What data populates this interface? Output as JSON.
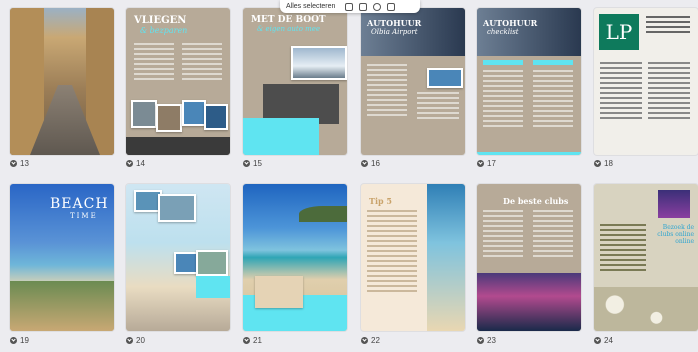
{
  "toolbar": {
    "select_all_label": "Alles selecteren"
  },
  "pages": [
    {
      "number": "13"
    },
    {
      "number": "14",
      "title": "VLIEGEN",
      "subtitle": "& bezparen"
    },
    {
      "number": "15",
      "title": "MET DE BOOT",
      "subtitle": "& eigen auto mee"
    },
    {
      "number": "16",
      "title": "AUTOHUUR",
      "subtitle": "Olbia Airport"
    },
    {
      "number": "17",
      "title": "AUTOHUUR",
      "subtitle": "checklist"
    },
    {
      "number": "18",
      "logo": "LP"
    },
    {
      "number": "19",
      "title": "BEACH",
      "subtitle": "TIME"
    },
    {
      "number": "20"
    },
    {
      "number": "21"
    },
    {
      "number": "22",
      "title": "Tip 5"
    },
    {
      "number": "23",
      "title": "De beste clubs"
    },
    {
      "number": "24",
      "subtitle": "Bezoek de clubs online online"
    }
  ],
  "colors": {
    "accent_cyan": "#5fe4f1",
    "beige": "#b7aa98",
    "background": "#ececf0"
  }
}
